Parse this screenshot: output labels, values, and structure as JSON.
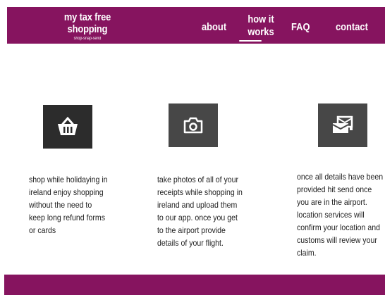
{
  "header": {
    "brand_title": "my tax free shopping",
    "brand_tagline": "shop-snap-send",
    "nav": {
      "about": "about",
      "how_it_works_line1": "how it",
      "how_it_works_line2": "works",
      "faq": "FAQ",
      "contact": "contact"
    }
  },
  "features": [
    {
      "icon": "shopping-basket-icon",
      "text_lines": [
        "shop while holidaying in",
        "ireland enjoy shopping",
        "without the need to",
        "keep long refund forms",
        "or cards"
      ]
    },
    {
      "icon": "camera-icon",
      "text_lines": [
        "take photos of all of your",
        "receipts while shopping in",
        "ireland and upload them",
        "to our app. once you get",
        "to the airport provide",
        "details of your flight."
      ]
    },
    {
      "icon": "mail-send-icon",
      "text_lines": [
        "once all details have been",
        "provided hit send once",
        "you are in the airport.",
        "location services will",
        "confirm your location and",
        "customs will review your",
        "claim."
      ]
    }
  ],
  "colors": {
    "brand": "#86145f",
    "icon_dark": "#2c2c2c",
    "icon_grey": "#474747"
  }
}
